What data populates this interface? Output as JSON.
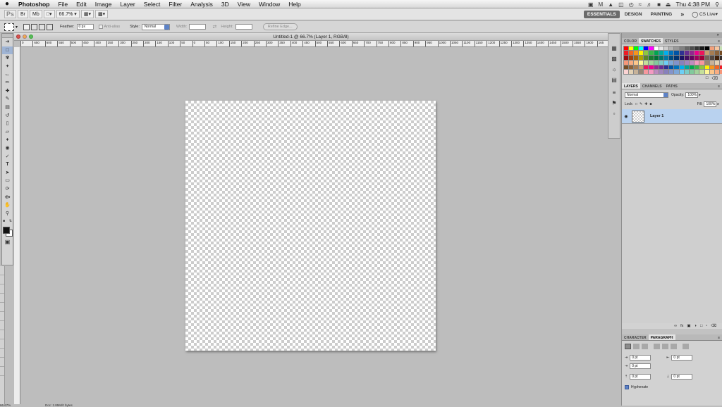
{
  "menubar": {
    "apple_icon": "apple-icon",
    "app_name": "Photoshop",
    "items": [
      "File",
      "Edit",
      "Image",
      "Layer",
      "Select",
      "Filter",
      "Analysis",
      "3D",
      "View",
      "Window",
      "Help"
    ],
    "clock": "Thu 4:38 PM"
  },
  "appbar": {
    "ps_logo": "Ps",
    "zoom": "66.7%",
    "workspaces": [
      "ESSENTIALS",
      "DESIGN",
      "PAINTING"
    ],
    "more": "»",
    "cs_live": "CS Live"
  },
  "options": {
    "feather_label": "Feather:",
    "feather_value": "0 px",
    "antialias_label": "Anti-alias",
    "style_label": "Style:",
    "style_value": "Normal",
    "width_label": "Width:",
    "height_label": "Height:",
    "refine_edge": "Refine Edge..."
  },
  "document": {
    "title": "Untitled-1 @ 66.7% (Layer 1, RGB/8)",
    "zoom_status": "66.67%",
    "doc_status": "Doc: 2.85M/0 bytes",
    "ruler_labels": [
      "0",
      "650",
      "600",
      "550",
      "500",
      "450",
      "400",
      "350",
      "300",
      "250",
      "200",
      "150",
      "100",
      "50",
      "0",
      "50",
      "100",
      "150",
      "200",
      "250",
      "300",
      "350",
      "400",
      "450",
      "500",
      "550",
      "600",
      "650",
      "700",
      "750",
      "800",
      "850",
      "900",
      "950",
      "1000",
      "1050",
      "1100",
      "1150",
      "1200",
      "1250",
      "1300",
      "1350",
      "1400",
      "1450",
      "1500",
      "1550",
      "1600",
      "165"
    ]
  },
  "color_panel": {
    "tabs": [
      "COLOR",
      "SWATCHES",
      "STYLES"
    ],
    "active": "SWATCHES"
  },
  "layers_panel": {
    "tabs": [
      "LAYERS",
      "CHANNELS",
      "PATHS"
    ],
    "blend_mode": "Normal",
    "opacity_label": "Opacity:",
    "opacity_value": "100%",
    "lock_label": "Lock:",
    "fill_label": "Fill:",
    "fill_value": "100%",
    "layer_name": "Layer 1"
  },
  "char_panel": {
    "tabs": [
      "CHARACTER",
      "PARAGRAPH"
    ],
    "active": "PARAGRAPH",
    "indent_left": "0 pt",
    "indent_right": "0 pt",
    "indent_first": "0 pt",
    "space_before": "0 pt",
    "space_after": "0 pt",
    "hyphenate": "Hyphenate"
  },
  "colors": {
    "selection": "#b9d2ef",
    "accent_blue": "#5d82c6"
  }
}
